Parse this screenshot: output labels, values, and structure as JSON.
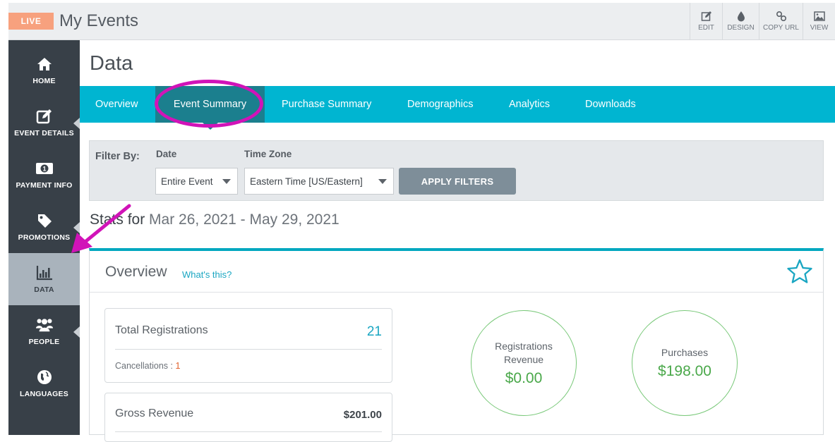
{
  "app": {
    "live_badge": "LIVE",
    "title": "My Events"
  },
  "toolbar": [
    {
      "label": "EDIT",
      "icon": "edit-icon"
    },
    {
      "label": "DESIGN",
      "icon": "droplet-icon"
    },
    {
      "label": "COPY URL",
      "icon": "link-icon"
    },
    {
      "label": "VIEW",
      "icon": "image-icon"
    }
  ],
  "sidebar": {
    "items": [
      {
        "label": "HOME",
        "icon": "home-icon"
      },
      {
        "label": "EVENT DETAILS",
        "icon": "edit-icon"
      },
      {
        "label": "PAYMENT INFO",
        "icon": "money-icon"
      },
      {
        "label": "PROMOTIONS",
        "icon": "tag-icon"
      },
      {
        "label": "DATA",
        "icon": "bar-chart-icon",
        "active": true
      },
      {
        "label": "PEOPLE",
        "icon": "people-icon"
      },
      {
        "label": "LANGUAGES",
        "icon": "globe-icon"
      }
    ]
  },
  "main": {
    "page_title": "Data",
    "tabs": [
      {
        "label": "Overview"
      },
      {
        "label": "Event Summary",
        "active": true
      },
      {
        "label": "Purchase Summary"
      },
      {
        "label": "Demographics"
      },
      {
        "label": "Analytics"
      },
      {
        "label": "Downloads"
      }
    ],
    "filter": {
      "label": "Filter By:",
      "date_label": "Date",
      "date_value": "Entire Event",
      "tz_label": "Time Zone",
      "tz_value": "Eastern Time [US/Eastern]",
      "apply": "APPLY FILTERS"
    },
    "stats": {
      "prefix": "Stats for",
      "range": "Mar 26, 2021 - May 29, 2021"
    },
    "overview": {
      "title": "Overview",
      "help": "What's this?",
      "total_registrations_label": "Total Registrations",
      "total_registrations_value": "21",
      "cancellations_label": "Cancellations :",
      "cancellations_value": "1",
      "gross_revenue_label": "Gross Revenue",
      "gross_revenue_value": "$201.00",
      "reg_revenue_label_1": "Registrations",
      "reg_revenue_label_2": "Revenue",
      "reg_revenue_value": "$0.00",
      "purchases_label": "Purchases",
      "purchases_value": "$198.00"
    }
  },
  "colors": {
    "live": "#f7a17e",
    "sidebar": "#384048",
    "sidebar_active": "#a9b3bc",
    "tabbar": "#00b5d1",
    "tab_active": "#1b7f8e",
    "accent_teal": "#1aa6c2",
    "green": "#4aa84a",
    "annotation": "#d113b8"
  }
}
